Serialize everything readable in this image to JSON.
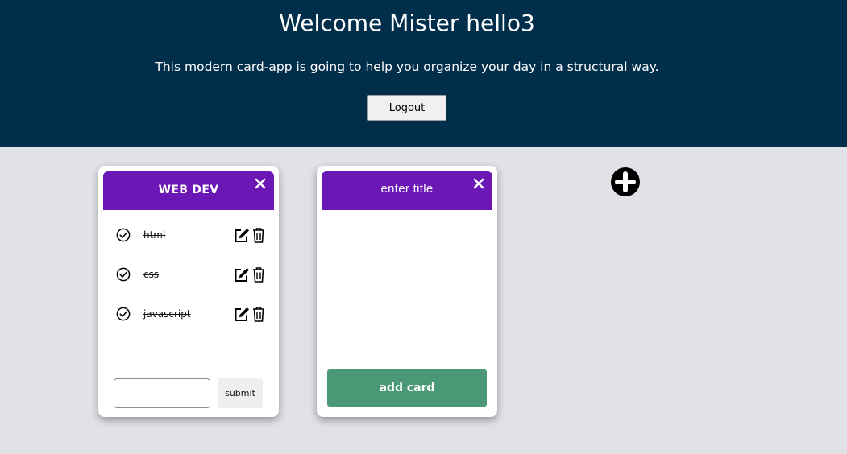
{
  "header": {
    "welcome": "Welcome Mister hello3",
    "tagline": "This modern card-app is going to help you organize your day in a structural way.",
    "logout_label": "Logout"
  },
  "cards": [
    {
      "title": "WEB DEV",
      "tasks": [
        {
          "label": "html",
          "done": true
        },
        {
          "label": "css",
          "done": true
        },
        {
          "label": "javascript",
          "done": true
        }
      ],
      "input_value": "",
      "submit_label": "submit"
    },
    {
      "title_placeholder": "enter title",
      "add_label": "add card"
    }
  ],
  "icons": {
    "close": "close-icon",
    "check": "check-circle-icon",
    "edit": "edit-icon",
    "delete": "trash-icon",
    "add": "plus-circle-icon"
  },
  "colors": {
    "header_bg": "#002e4b",
    "page_bg": "#e1e2e7",
    "card_header": "#6a17b5",
    "add_card_button": "#4b9876"
  }
}
